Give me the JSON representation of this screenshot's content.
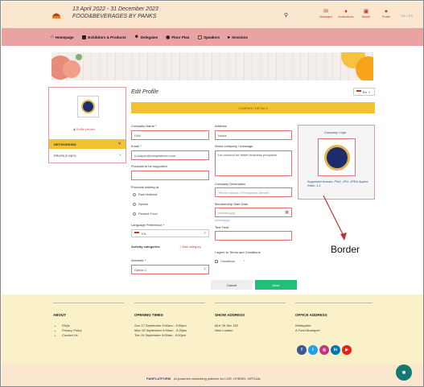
{
  "header": {
    "dates": "13 April 2022 - 31 December 2023",
    "event_name": "FOOD&BEVERAGES BY PANKS",
    "icons": [
      {
        "name": "messages",
        "label": "Messages",
        "icon": "envelope-icon"
      },
      {
        "name": "notifications",
        "label": "Notifications",
        "icon": "bell-icon"
      },
      {
        "name": "basket",
        "label": "Basket",
        "icon": "cart-icon"
      },
      {
        "name": "profile",
        "label": "Profile",
        "icon": "user-icon"
      }
    ],
    "lang_mini": "EN  •  ES"
  },
  "nav": [
    {
      "label": "Homepage",
      "icon": "home-icon"
    },
    {
      "label": "Exhibitors & Products",
      "icon": "store-icon"
    },
    {
      "label": "Delegates",
      "icon": "people-icon"
    },
    {
      "label": "Floor Plan",
      "icon": "map-icon"
    },
    {
      "label": "Speakers",
      "icon": "speaker-icon"
    },
    {
      "label": "Sessions",
      "icon": "megaphone-icon"
    }
  ],
  "left_panel": {
    "profile_preview": "Profile preview",
    "networking": "NETWORKING",
    "profile_info": "PROFILE INFO"
  },
  "main": {
    "title": "Edit Profile",
    "lang": "En",
    "company_details": "COMPANY DETAILS",
    "fields": {
      "company_name_label": "Company Name *",
      "company_name_value": "FAN",
      "email_label": "Email *",
      "email_value": "b.kasper@exbaplatform.com",
      "products_label": "Products to be supported",
      "products_looking_label": "Products looking at",
      "radio1": "Raw Material",
      "radio2": "Spices",
      "radio3": "Packed Food",
      "language_pref_label": "Language Preference *",
      "language_pref_value": "EN",
      "activity_label": "Activity categories",
      "add_category": "+ Add category",
      "interests_label": "Interests *",
      "interests_value": "Option 1",
      "address_label": "Address",
      "address_value": "Noida",
      "about_label": "About company / message",
      "about_value": "Let connect for better business prospects",
      "company_desc_label": "Company Description",
      "company_desc_placeholder": "Tell the details of Rendation Benefit",
      "membership_label": "Membership Start Date",
      "membership_placeholder": "dd/mm/yyyy",
      "membership_hint": "dd/mm/yyyy",
      "text_label": "Text Field",
      "agree_label": "I agree to Terms and Conditions",
      "checkbox_label": "Checkbox",
      "cancel": "Cancel",
      "save": "Save"
    },
    "logo_card": {
      "title": "Company Logo",
      "note": "Supported formats: PNG, JPG, JPEG Aspect Ratio: 1:1"
    }
  },
  "annotation": {
    "label": "Border"
  },
  "footer": {
    "about_title": "ABOUT",
    "about_items": [
      "FAQs",
      "Privacy Policy",
      "Contact Us"
    ],
    "opening_title": "OPENING TIMES",
    "opening_items": [
      "Sun 17 September  9:00am - 5:00pm",
      "Mon 18 September  9:00am - 5:30pm",
      "Tue 19 September  9:00am - 5:00pm"
    ],
    "show_title": "SHOW ADDRESS",
    "show_items": [
      "BLK 39 Sec 118",
      "New London"
    ],
    "office_title": "OFFICE ADDRESS",
    "office_items": [
      "WebbyAne",
      "A Food Boutique!"
    ],
    "socials": [
      {
        "name": "facebook",
        "glyph": "f",
        "color": "#3b5998"
      },
      {
        "name": "twitter",
        "glyph": "t",
        "color": "#1da1f2"
      },
      {
        "name": "instagram",
        "glyph": "◎",
        "color": "#c13584"
      },
      {
        "name": "linkedin",
        "glyph": "in",
        "color": "#0077b5"
      },
      {
        "name": "youtube",
        "glyph": "▶",
        "color": "#e62117"
      }
    ],
    "powered_brand": "PANPLATFORM",
    "powered_text": "AI powered networking platform for LIVE, HYBRID, VIRTUAL"
  }
}
